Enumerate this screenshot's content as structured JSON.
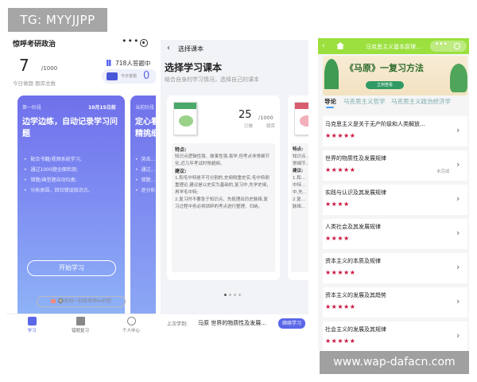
{
  "watermark": {
    "top": "TG: MYYJJPP",
    "bottom": "www.wap-dafacn.com"
  },
  "phone1": {
    "title": "惊呼考研政治",
    "menu_dots": "•••",
    "days_count": "7",
    "total": "/1000",
    "stats_label": "今日做题  题库总数",
    "sign_in": "718人答题中",
    "pill_text": "今日答题",
    "pill_num": "0",
    "card1": {
      "stage": "第一阶段",
      "date": "10月15日前",
      "headline": "边学边练，自动记录学习问题",
      "bullets": [
        "配合书籍/视频系统学习;",
        "通过1000题全面检测;",
        "错题/典型题自动归类;",
        "分析原因，回归错误知识点。"
      ],
      "button": "开始学习"
    },
    "card2": {
      "stage": "当前阶段",
      "headline": "定心看…\n精挑细…",
      "bullets": [
        "突击…",
        "通过…",
        "错题…",
        "逐分析…"
      ]
    },
    "letter": "🔘收到一封给考研er的信",
    "tabs": [
      "学习",
      "错题复习",
      "个人中心"
    ]
  },
  "phone2": {
    "back": "‹",
    "bar_title": "选择课本",
    "heading": "选择学习课本",
    "subtitle": "结合自身的学习情况，选择自己的课本",
    "count": "25",
    "count_total": "/1000",
    "done_label": "已做",
    "bank_label": "题库",
    "desc": [
      {
        "h": "特点:"
      },
      {
        "t": "知识点逻辑性强、故事性强,易学,但考点非常细节化,近几年考试时常超纲。"
      },
      {
        "h": "建议:"
      },
      {
        "t": "1.和毛中特是不可分割的,史纲侧重史实,毛中特侧重理论,建议是以史实为基础的,复习中,先学史纲，再学毛中特;"
      },
      {
        "t": "2.复习时不要急于知识点，先梳理出历史脉络,复习过程中务必将琐碎的考点进行整理、归纳。"
      }
    ],
    "ghost_desc": [
      "特点:",
      "知识点…",
      "常细节…",
      "建议:",
      "1.和…",
      "中特…",
      "中,先…",
      "2.复…",
      "脉络…"
    ],
    "last_label": "上次学到:",
    "last_book": "马原 世界的物质性及发展...",
    "continue": "继续学习"
  },
  "phone3": {
    "back": "‹",
    "title": "马克思主义基本原理…",
    "banner_title": "《马原》一复习方法",
    "banner_sub": "立刻查看",
    "tabs": [
      "导论",
      "马克思主义哲学",
      "马克思主义政治经济学"
    ],
    "items": [
      {
        "title": "马克思主义是关于无产阶级和人类解放…",
        "stars": "★★★★★",
        "status": ""
      },
      {
        "title": "世界的物质性及发展规律",
        "stars": "★★★★★",
        "status": "未完成"
      },
      {
        "title": "实践与认识及其发展规律",
        "stars": "★★★★",
        "status": ""
      },
      {
        "title": "人类社会及其发展规律",
        "stars": "★★★★",
        "status": ""
      },
      {
        "title": "资本主义的本质及规律",
        "stars": "★★★★★",
        "status": ""
      },
      {
        "title": "资本主义的发展及其趋势",
        "stars": "★★★★★",
        "status": ""
      },
      {
        "title": "社会主义的发展及其规律",
        "stars": "★★★★★",
        "status": ""
      }
    ]
  },
  "colors": {
    "primary": "#5a67e8",
    "green_header": "#9be03e",
    "star": "#c8163e"
  }
}
